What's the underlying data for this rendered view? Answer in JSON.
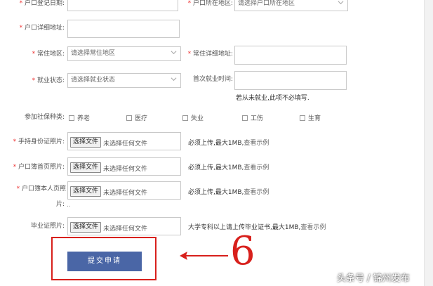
{
  "form": {
    "register_date": {
      "label": "户口登记日期:"
    },
    "hukou_region": {
      "label": "户口所在地区:",
      "placeholder": "请选择户口所在地区"
    },
    "hukou_address": {
      "label": "户口详细地址:"
    },
    "residence_region": {
      "label": "常住地区:",
      "placeholder": "请选择常住地区"
    },
    "residence_address": {
      "label": "常住详细地址:"
    },
    "employment_status": {
      "label": "就业状态:",
      "placeholder": "请选择就业状态"
    },
    "first_employment": {
      "label": "首次就业时间:",
      "note": "若从未就业,此项不必填写."
    },
    "social_insurance": {
      "label": "参加社保种类:",
      "options": [
        "养老",
        "医疗",
        "失业",
        "工伤",
        "生育"
      ]
    },
    "uploads": [
      {
        "label": "手持身份证照片:",
        "button": "选择文件",
        "status": "未选择任何文件",
        "note": "必须上传,最大1MB,",
        "link": "查看示例"
      },
      {
        "label": "户口簿首页照片:",
        "button": "选择文件",
        "status": "未选择任何文件",
        "note": "必须上传,最大1MB,",
        "link": "查看示例"
      },
      {
        "label": "户口簿本人页照",
        "label2": "片:",
        "button": "选择文件",
        "status": "未选择任何文件",
        "note": "必须上传,最大1MB,",
        "link": "查看示例"
      },
      {
        "label": "毕业证照片:",
        "button": "选择文件",
        "status": "未选择任何文件",
        "note": "大学专科以上请上传毕业证书,最大1MB,",
        "link": "查看示例"
      }
    ],
    "separator": "..",
    "submit_label": "提交申请"
  },
  "annotation": {
    "step_number": "6",
    "color": "#d8201c"
  },
  "watermark": "头条号 / 锦州发布",
  "colors": {
    "submit_bg": "#4a66a6",
    "required": "#ee3333"
  }
}
